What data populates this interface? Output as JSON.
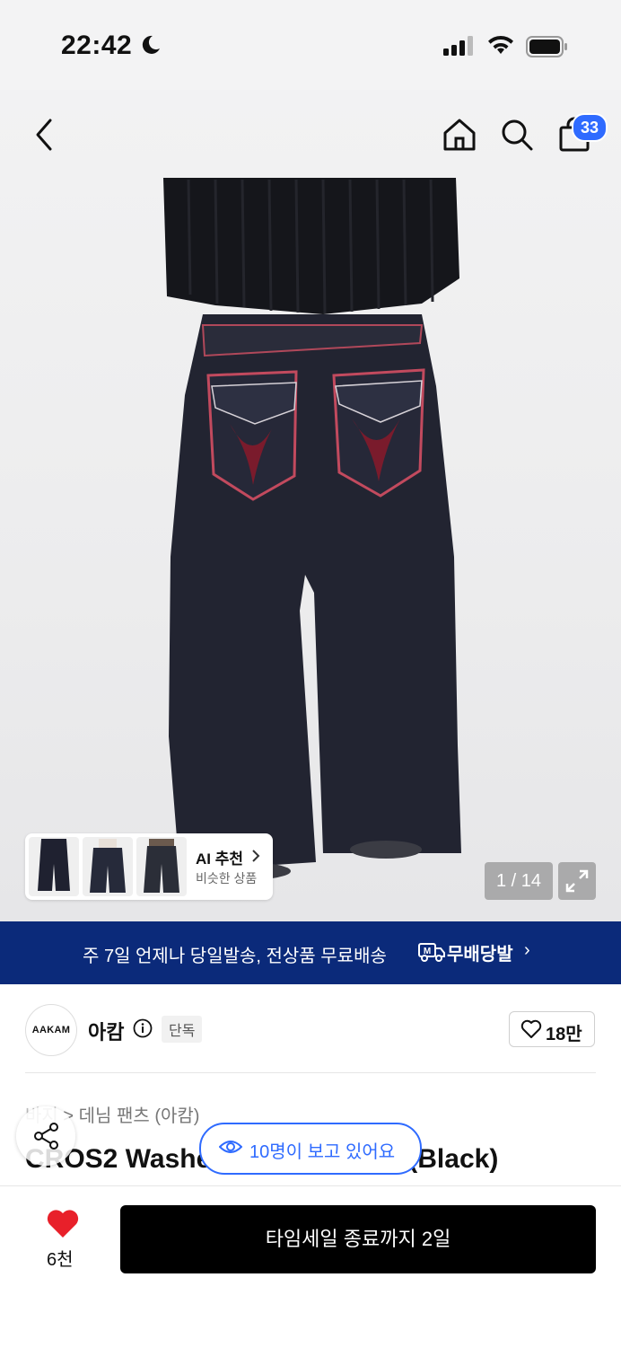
{
  "status_bar": {
    "time": "22:42"
  },
  "header": {
    "cart_count": "33"
  },
  "gallery": {
    "ai_title": "AI 추천",
    "ai_subtitle": "비슷한 상품",
    "counter": "1 / 14"
  },
  "banner": {
    "text": "주 7일 언제나 당일발송, 전상품 무료배송",
    "brand": "무배당발"
  },
  "brand": {
    "logo_text": "AAKAM",
    "name": "아캄",
    "tag": "단독",
    "likes": "18만"
  },
  "product": {
    "breadcrumb_parent": "바지",
    "breadcrumb_child": "데님 팬츠 (아캄)",
    "title_left": "CROS2 Washe",
    "title_right": "(Black)"
  },
  "viewers": {
    "text": "10명이 보고 있어요"
  },
  "bottom": {
    "heart_count": "6천",
    "buy_label": "타임세일 종료까지 2일"
  },
  "colors": {
    "accent": "#2f6bff",
    "banner": "#0b2a7a",
    "heart": "#e8202a"
  }
}
